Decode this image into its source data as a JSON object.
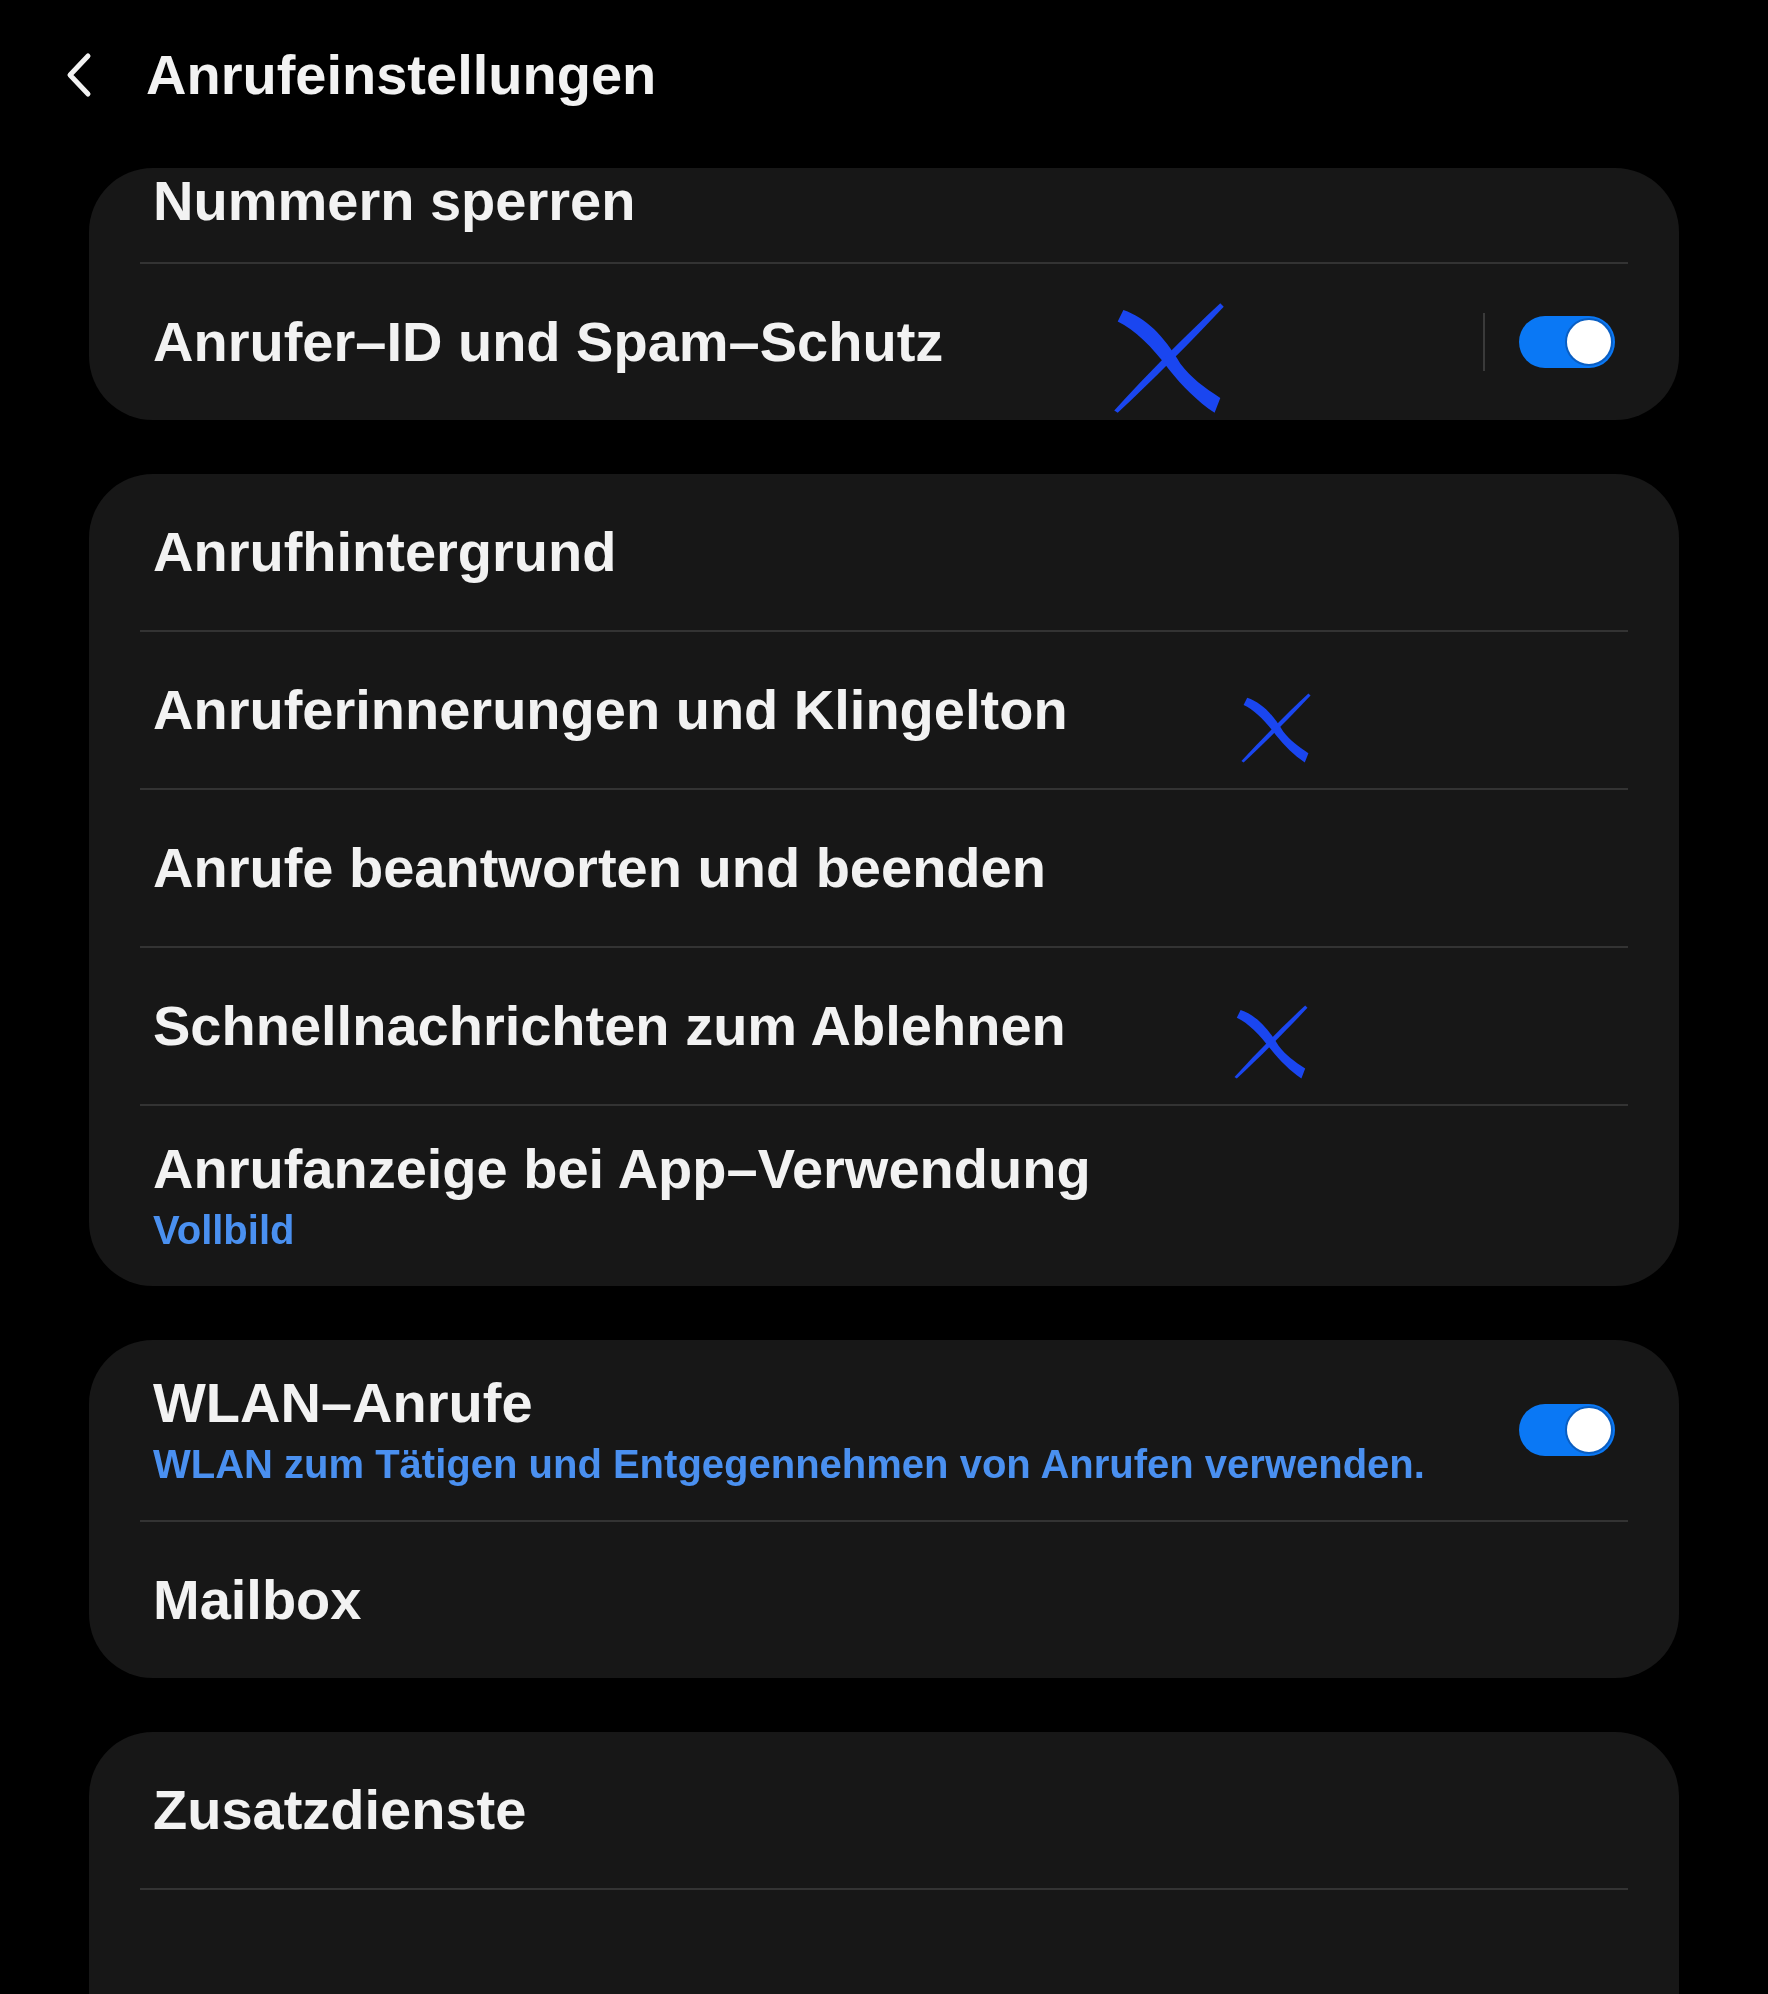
{
  "header": {
    "title": "Anrufeinstellungen"
  },
  "groups": [
    {
      "items": [
        {
          "kind": "link",
          "title": "Nummern sperren"
        },
        {
          "kind": "switch",
          "title": "Anrufer–ID und Spam–Schutz",
          "on": true,
          "split": true
        }
      ]
    },
    {
      "items": [
        {
          "kind": "link",
          "title": "Anrufhintergrund"
        },
        {
          "kind": "link",
          "title": "Anruferinnerungen und Klingelton"
        },
        {
          "kind": "link",
          "title": "Anrufe beantworten und beenden"
        },
        {
          "kind": "link",
          "title": "Schnellnachrichten zum Ablehnen"
        },
        {
          "kind": "link",
          "title": "Anrufanzeige bei App–Verwendung",
          "subtitle": "Vollbild"
        }
      ]
    },
    {
      "items": [
        {
          "kind": "switch",
          "title": "WLAN–Anrufe",
          "subtitle": "WLAN zum Tätigen und Entgegennehmen von Anrufen verwenden.",
          "on": true,
          "split": false
        },
        {
          "kind": "link",
          "title": "Mailbox"
        }
      ]
    },
    {
      "items": [
        {
          "kind": "link",
          "title": "Zusatzdienste"
        }
      ],
      "continues": true
    }
  ]
}
